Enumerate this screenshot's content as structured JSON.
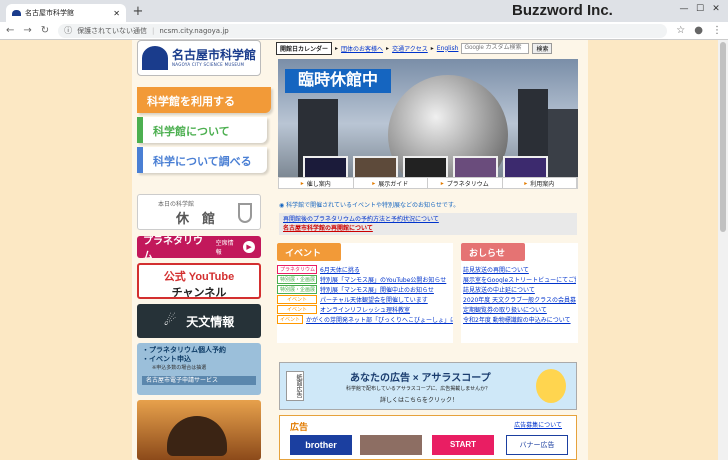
{
  "browser": {
    "tab_title": "名古屋市科学館",
    "new_tab": "+",
    "brand": "Buzzword Inc.",
    "insecure_label": "保護されていない通信",
    "url": "ncsm.city.nagoya.jp"
  },
  "logo": {
    "jp": "名古屋市科学館",
    "en": "NAGOYA CITY SCIENCE MUSEUM"
  },
  "left_tabs": [
    {
      "label": "科学館を利用する",
      "color": "#f29a38"
    },
    {
      "label": "科学館について",
      "color": "#4caf50"
    },
    {
      "label": "科学について調べる",
      "color": "#4a7fd4"
    }
  ],
  "today": {
    "label": "本日の科学館",
    "status": "休　館"
  },
  "planetarium": {
    "label": "プラネタリウム",
    "sub": "空席情報"
  },
  "youtube": {
    "line1": "公式 YouTube",
    "line2": "チャンネル"
  },
  "astro": {
    "label": "天文情報"
  },
  "reserve": {
    "line1": "・プラネタリウム個人予約",
    "line2": "・イベント申込",
    "line3": "※申込多数の場合は抽選",
    "line4": "名古屋市電子申請サービス"
  },
  "toplinks": {
    "calendar": "開館日カレンダー",
    "links": [
      "団体のお客様へ",
      "交通アクセス",
      "English"
    ],
    "search_placeholder": "Google カスタム検索",
    "search_button": "検索"
  },
  "hero": {
    "banner": "臨時休館中",
    "nav": [
      "催し案内",
      "展示ガイド",
      "プラネタリウム",
      "利用案内"
    ]
  },
  "notice": {
    "intro": "科学館で開催されているイベントや特別展などのお知らせです。",
    "link1": "再開館後のプラネタリウムの予約方法と予約状況について",
    "link2": "名古屋市科学館の再開館について"
  },
  "events": {
    "heading": "イベント",
    "items": [
      {
        "tag": "プラネタリウム",
        "text": "6月天体に挑る",
        "tagcolor": "#e91e63"
      },
      {
        "tag": "特別展・企画展",
        "text": "特別展「マンモス展」のYouTube公開お知らせ",
        "tagcolor": "#4caf50"
      },
      {
        "tag": "特別展・企画展",
        "text": "特別展「マンモス展」開催中止のお知らせ",
        "tagcolor": "#4caf50"
      },
      {
        "tag": "イベント",
        "text": "パーチャル天体観望会を開催しています",
        "tagcolor": "#ff9800"
      },
      {
        "tag": "イベント",
        "text": "オンラインリフレッシュ理科教室",
        "tagcolor": "#ff9800"
      },
      {
        "tag": "イベント",
        "text": "かがくの芽開発ネット部「ぴっくりへこびょーしょ」について",
        "tagcolor": "#ff9800"
      }
    ]
  },
  "news": {
    "heading": "おしらせ",
    "items": [
      "誌見放送の再開について",
      "展示室をGoogleストリートビューにてご覧…",
      "誌見放送の中止延について",
      "2020年度 天文クラブ一般クラスの会員募集",
      "定期観覧券の取り扱いについて",
      "令和2年度 動物標識館の申込みについて"
    ]
  },
  "ad_banner": {
    "left": "紙面広告",
    "title": "あなたの広告 × アサラスコープ",
    "body": "科学館で配布しているアサラスコープに、広告掲載しませんか？",
    "cta": "詳しくはこちらをクリック！"
  },
  "ads": {
    "heading": "広告",
    "recruit": "広告募集について",
    "brother": "brother",
    "start": "START",
    "banner": "バナー広告"
  }
}
